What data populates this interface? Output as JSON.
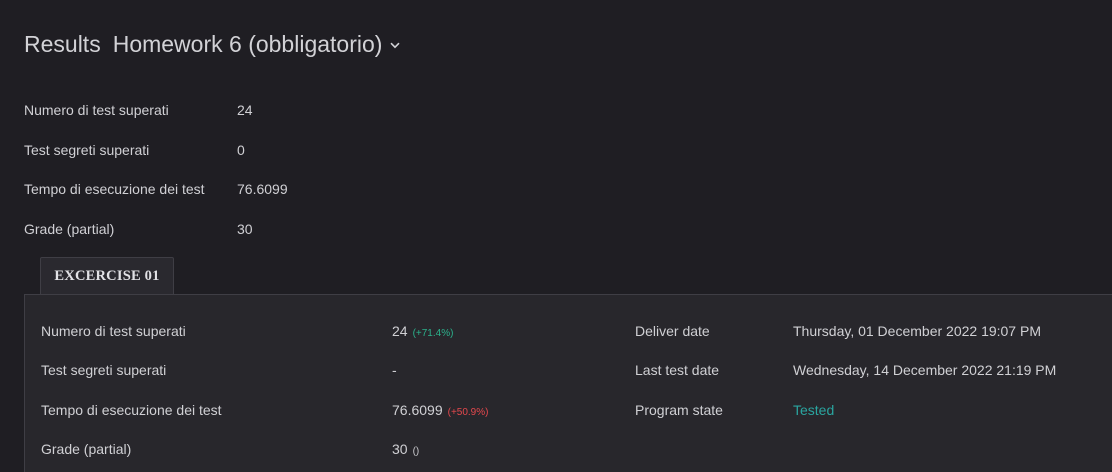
{
  "header": {
    "title": "Results",
    "homework": "Homework 6 (obbligatorio)",
    "dropdown_icon": "chevron-down-icon"
  },
  "summary": [
    {
      "label": "Numero di test superati",
      "value": "24"
    },
    {
      "label": "Test segreti superati",
      "value": "0"
    },
    {
      "label": "Tempo di esecuzione dei test",
      "value": "76.6099"
    },
    {
      "label": "Grade (partial)",
      "value": "30"
    }
  ],
  "tabs": [
    {
      "label": "EXCERCISE 01",
      "active": true
    }
  ],
  "exercise": {
    "left": [
      {
        "label": "Numero di test superati",
        "value": "24",
        "delta": "(+71.4%)"
      },
      {
        "label": "Test segreti superati",
        "value": "-",
        "delta": ""
      },
      {
        "label": "Tempo di esecuzione dei test",
        "value": "76.6099",
        "delta": "(+50.9%)"
      },
      {
        "label": "Grade (partial)",
        "value": "30",
        "delta": "()"
      }
    ],
    "right": [
      {
        "label": "Deliver date",
        "value": "Thursday, 01 December 2022 19:07 PM"
      },
      {
        "label": "Last test date",
        "value": "Wednesday, 14 December 2022 21:19 PM"
      },
      {
        "label": "Program state",
        "value": "Tested"
      }
    ]
  },
  "colors": {
    "background": "#1f1e23",
    "panel": "#28272c",
    "positive": "#2bb28c",
    "negative": "#e5484d",
    "state_tested": "#2aa5a0"
  }
}
